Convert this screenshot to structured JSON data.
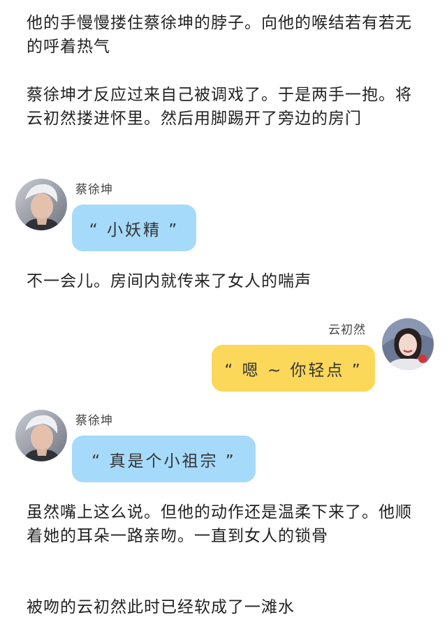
{
  "paragraphs": [
    "他的手慢慢搂住蔡徐坤的脖子。向他的喉结若有若无的呼着热气",
    "蔡徐坤才反应过来自己被调戏了。于是两手一抱。将云初然搂进怀里。然后用脚踢开了旁边的房门",
    "不一会儿。房间内就传来了女人的喘声",
    "虽然嘴上这么说。但他的动作还是温柔下来了。他顺着她的耳朵一路亲吻。一直到女人的锁骨",
    "被吻的云初然此时已经软成了一滩水"
  ],
  "messages": [
    {
      "speaker": "蔡徐坤",
      "text": "“ 小妖精 ”",
      "side": "left",
      "color": "#a6dafa"
    },
    {
      "speaker": "云初然",
      "text": "“ 嗯 ~ 你轻点 ”",
      "side": "right",
      "color": "#fcd85a"
    },
    {
      "speaker": "蔡徐坤",
      "text": "“ 真是个小祖宗 ”",
      "side": "left",
      "color": "#a6dafa"
    }
  ]
}
